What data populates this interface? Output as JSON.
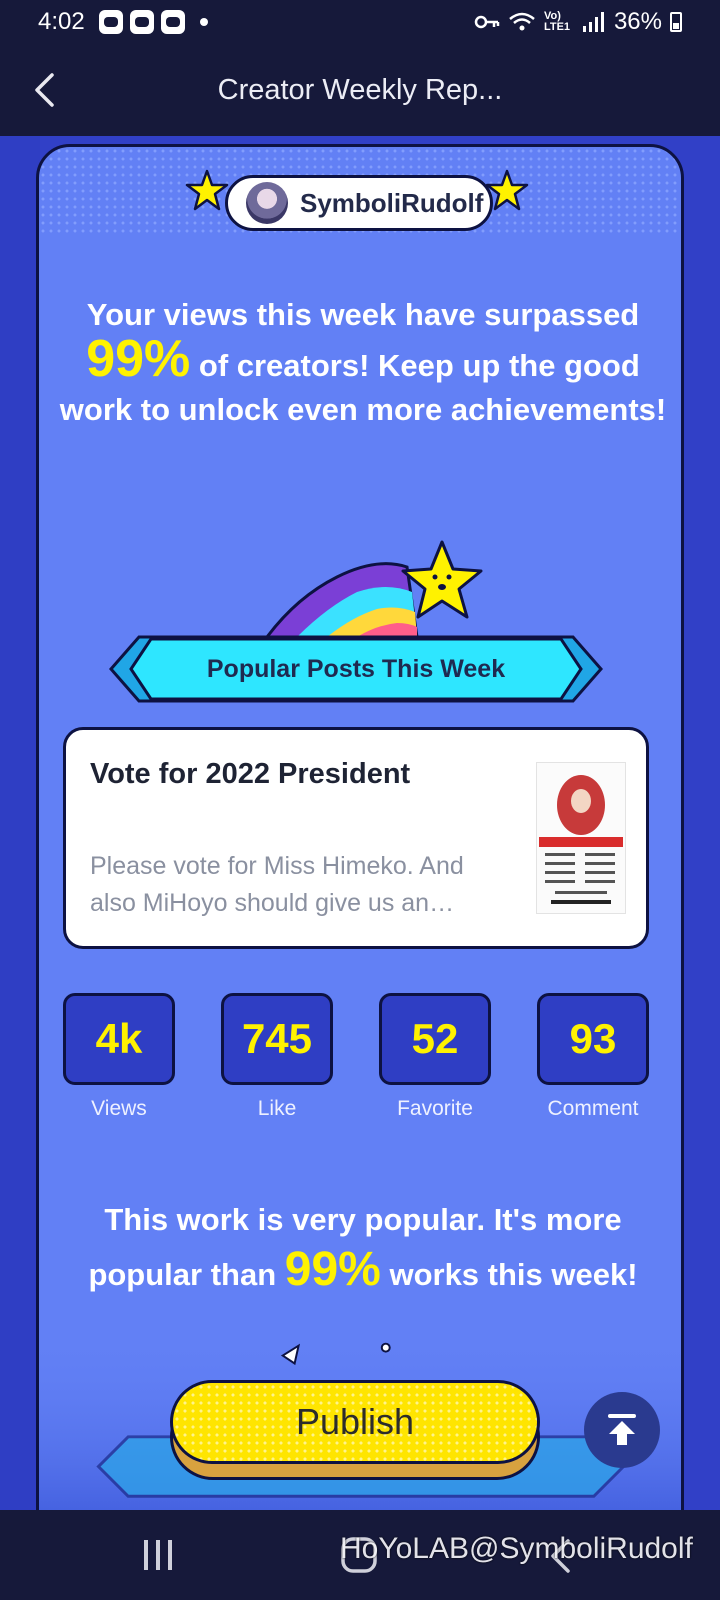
{
  "status_bar": {
    "time": "4:02",
    "battery": "36%",
    "network_label": "Vo) LTE1"
  },
  "header": {
    "title": "Creator Weekly Rep..."
  },
  "profile": {
    "username": "SymboliRudolf"
  },
  "headline": {
    "part1": "Your views this week have surpassed",
    "percent": "99%",
    "part2": " of creators! Keep up the good work to unlock even more achievements!"
  },
  "section": {
    "title": "Popular Posts This Week"
  },
  "post": {
    "title": "Vote for 2022 President",
    "excerpt": "Please vote for Miss Himeko. And also MiHoyo should give us an…"
  },
  "stats": [
    {
      "value": "4k",
      "label": "Views"
    },
    {
      "value": "745",
      "label": "Like"
    },
    {
      "value": "52",
      "label": "Favorite"
    },
    {
      "value": "93",
      "label": "Comment"
    }
  ],
  "popular": {
    "part1": "This work is very popular. It's more popular than ",
    "percent": "99%",
    "part2": " works this week!"
  },
  "actions": {
    "publish_label": "Publish"
  },
  "footer": {
    "watermark": "HoYoLAB@SymboliRudolf"
  },
  "colors": {
    "card_bg": "#6280f5",
    "accent_yellow": "#fff200",
    "banner_cyan": "#2ee6ff",
    "dark_bg": "#16193a"
  }
}
